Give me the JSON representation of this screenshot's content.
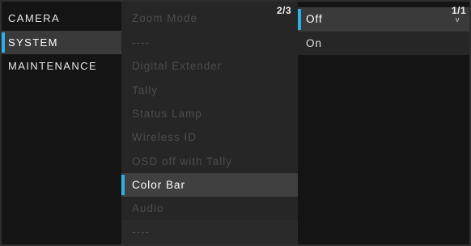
{
  "categories": [
    {
      "label": "CAMERA"
    },
    {
      "label": "SYSTEM"
    },
    {
      "label": "MAINTENANCE"
    }
  ],
  "system_items": [
    {
      "label": "Zoom Mode"
    },
    {
      "label": "----"
    },
    {
      "label": "Digital Extender"
    },
    {
      "label": "Tally"
    },
    {
      "label": "Status Lamp"
    },
    {
      "label": "Wireless ID"
    },
    {
      "label": "OSD off with Tally"
    },
    {
      "label": "Color Bar"
    },
    {
      "label": "Audio"
    },
    {
      "label": "----"
    }
  ],
  "system_page": "2/3",
  "options": [
    {
      "label": "Off"
    },
    {
      "label": "On"
    }
  ],
  "options_page": "1/1",
  "options_scroll_glyph": "v",
  "colors": {
    "accent": "#2bb0e8",
    "selected_row": "#3b3b3b",
    "disabled_text": "#4c4c4c"
  }
}
